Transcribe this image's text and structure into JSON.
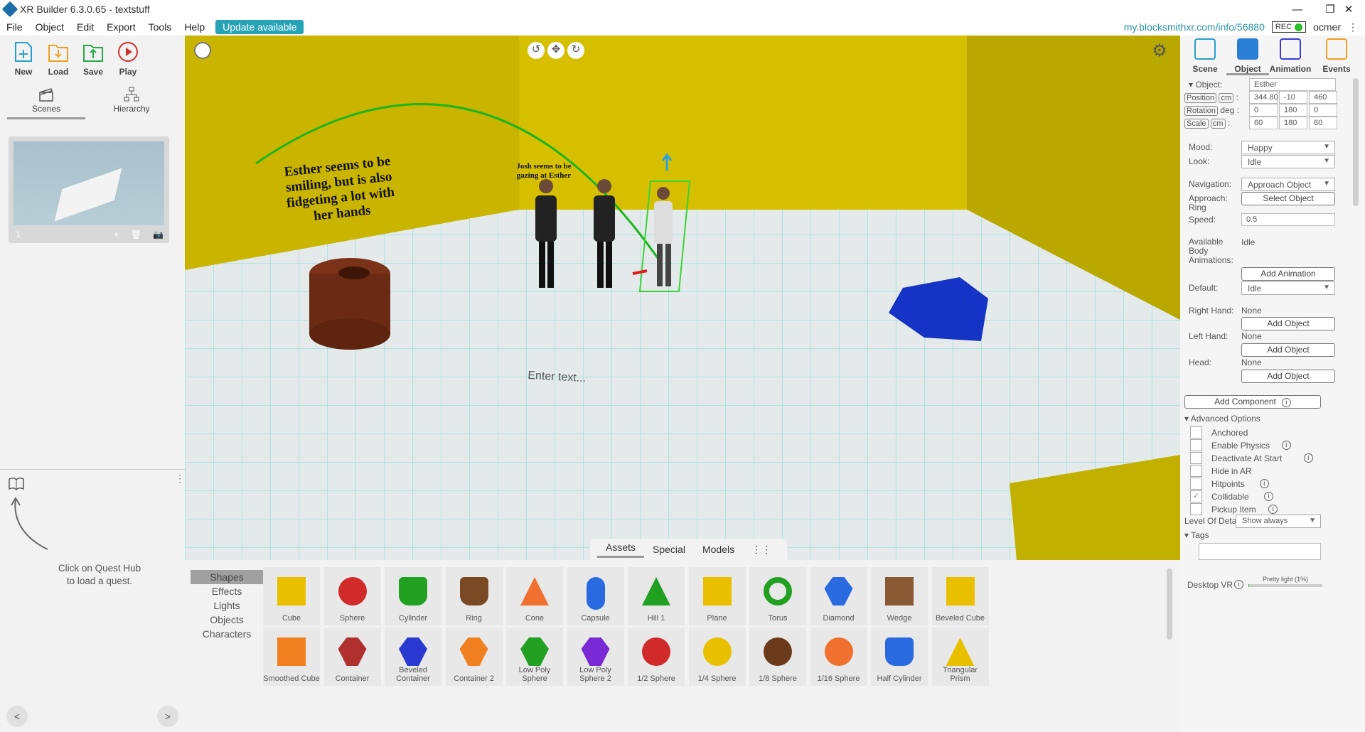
{
  "window": {
    "title": "XR Builder 6.3.0.65 - textstuff"
  },
  "menu": {
    "items": [
      "File",
      "Object",
      "Edit",
      "Export",
      "Tools",
      "Help"
    ],
    "update_label": "Update available",
    "link": "my.blocksmithxr.com/info/56880",
    "rec_label": "REC",
    "user": "ocmer"
  },
  "toolbar": {
    "new": "New",
    "load": "Load",
    "save": "Save",
    "play": "Play"
  },
  "left_tabs": {
    "scenes": "Scenes",
    "hierarchy": "Hierarchy"
  },
  "scene_card": {
    "number": "1"
  },
  "quest_hub": {
    "hint_line1": "Click on Quest Hub",
    "hint_line2": "to load a quest."
  },
  "nav": {
    "prev": "<",
    "next": ">"
  },
  "viewport": {
    "text_esther": [
      "Esther seems to be",
      "smiling, but is also",
      "fidgeting a lot with",
      "her hands"
    ],
    "text_josh": [
      "Josh seems to be",
      "gazing at Esther"
    ],
    "enter_text": "Enter text...",
    "colors": {
      "wall": "#c9b500",
      "floor": "#e8ecec",
      "cylinder": "#6b2a14",
      "blue_shape": "#1533c4",
      "selection": "#3bd13b"
    }
  },
  "assets": {
    "tabs": [
      "Assets",
      "Special",
      "Models"
    ],
    "categories": [
      "Shapes",
      "Effects",
      "Lights",
      "Objects",
      "Characters"
    ],
    "row1": [
      "Cube",
      "Sphere",
      "Cylinder",
      "Ring",
      "Cone",
      "Capsule",
      "Hill 1",
      "Plane",
      "Torus",
      "Diamond",
      "Wedge",
      "Beveled Cube"
    ],
    "row2": [
      "Smoothed Cube",
      "Container",
      "Beveled Container",
      "Container 2",
      "Low Poly Sphere",
      "Low Poly Sphere 2",
      "1/2 Sphere",
      "1/4 Sphere",
      "1/8 Sphere",
      "1/16 Sphere",
      "Half Cylinder",
      "Triangular Prism"
    ]
  },
  "inspector": {
    "tabs": [
      "Scene",
      "Object",
      "Animation",
      "Events"
    ],
    "object_label": "Object:",
    "object_name": "Esther",
    "position_label": "Position",
    "position_unit": "cm",
    "position": [
      "344.80",
      "-10",
      "460"
    ],
    "rotation_label": "Rotation",
    "rotation_unit": "deg",
    "rotation": [
      "0",
      "180",
      "0"
    ],
    "scale_label": "Scale",
    "scale_unit": "cm",
    "scale": [
      "60",
      "180",
      "60"
    ],
    "mood_label": "Mood:",
    "mood": "Happy",
    "look_label": "Look:",
    "look": "Idle",
    "navigation_label": "Navigation:",
    "navigation": "Approach Object",
    "approach_label": "Approach:",
    "ring_label": "Ring",
    "select_object": "Select Object",
    "speed_label": "Speed:",
    "speed": "0.5",
    "available_label": "Available Body Animations:",
    "available_value": "Idle",
    "add_animation": "Add Animation",
    "default_label": "Default:",
    "default_value": "Idle",
    "right_hand_label": "Right Hand:",
    "right_hand": "None",
    "left_hand_label": "Left Hand:",
    "left_hand": "None",
    "head_label": "Head:",
    "head": "None",
    "add_object": "Add Object",
    "add_component": "Add Component",
    "advanced": "Advanced Options",
    "options": [
      "Anchored",
      "Enable Physics",
      "Deactivate At Start",
      "Hide in AR",
      "Hitpoints",
      "Collidable",
      "Pickup Item"
    ],
    "lod_label": "Level Of Detail:",
    "lod": "Show always",
    "tags_label": "Tags",
    "desktop_vr": "Desktop VR",
    "light_label": "Pretty light (1%)"
  }
}
